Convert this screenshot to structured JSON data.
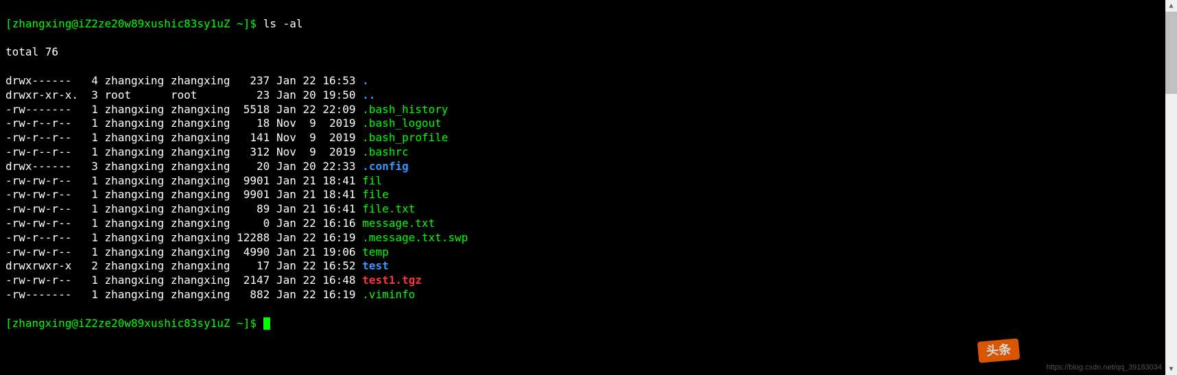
{
  "prompt": "[zhangxing@iZ2ze20w89xushic83sy1uZ ~]$ ",
  "command": "ls -al",
  "total_line": "total 76",
  "rows": [
    {
      "perm": "drwx------ ",
      "links": " 4",
      "owner": "zhangxing",
      "group": "zhangxing",
      "size": "  237",
      "month": "Jan",
      "day": "22",
      "time": "16:53",
      "name": ".",
      "cls": "blue"
    },
    {
      "perm": "drwxr-xr-x.",
      "links": " 3",
      "owner": "root     ",
      "group": "root     ",
      "size": "   23",
      "month": "Jan",
      "day": "20",
      "time": "19:50",
      "name": "..",
      "cls": "blue"
    },
    {
      "perm": "-rw------- ",
      "links": " 1",
      "owner": "zhangxing",
      "group": "zhangxing",
      "size": " 5518",
      "month": "Jan",
      "day": "22",
      "time": "22:09",
      "name": ".bash_history",
      "cls": "green"
    },
    {
      "perm": "-rw-r--r-- ",
      "links": " 1",
      "owner": "zhangxing",
      "group": "zhangxing",
      "size": "   18",
      "month": "Nov",
      "day": " 9",
      "time": " 2019",
      "name": ".bash_logout",
      "cls": "green"
    },
    {
      "perm": "-rw-r--r-- ",
      "links": " 1",
      "owner": "zhangxing",
      "group": "zhangxing",
      "size": "  141",
      "month": "Nov",
      "day": " 9",
      "time": " 2019",
      "name": ".bash_profile",
      "cls": "green"
    },
    {
      "perm": "-rw-r--r-- ",
      "links": " 1",
      "owner": "zhangxing",
      "group": "zhangxing",
      "size": "  312",
      "month": "Nov",
      "day": " 9",
      "time": " 2019",
      "name": ".bashrc",
      "cls": "green"
    },
    {
      "perm": "drwx------ ",
      "links": " 3",
      "owner": "zhangxing",
      "group": "zhangxing",
      "size": "   20",
      "month": "Jan",
      "day": "20",
      "time": "22:33",
      "name": ".config",
      "cls": "blue"
    },
    {
      "perm": "-rw-rw-r-- ",
      "links": " 1",
      "owner": "zhangxing",
      "group": "zhangxing",
      "size": " 9901",
      "month": "Jan",
      "day": "21",
      "time": "18:41",
      "name": "fil",
      "cls": "green"
    },
    {
      "perm": "-rw-rw-r-- ",
      "links": " 1",
      "owner": "zhangxing",
      "group": "zhangxing",
      "size": " 9901",
      "month": "Jan",
      "day": "21",
      "time": "18:41",
      "name": "file",
      "cls": "green"
    },
    {
      "perm": "-rw-rw-r-- ",
      "links": " 1",
      "owner": "zhangxing",
      "group": "zhangxing",
      "size": "   89",
      "month": "Jan",
      "day": "21",
      "time": "16:41",
      "name": "file.txt",
      "cls": "green"
    },
    {
      "perm": "-rw-rw-r-- ",
      "links": " 1",
      "owner": "zhangxing",
      "group": "zhangxing",
      "size": "    0",
      "month": "Jan",
      "day": "22",
      "time": "16:16",
      "name": "message.txt",
      "cls": "green"
    },
    {
      "perm": "-rw-r--r-- ",
      "links": " 1",
      "owner": "zhangxing",
      "group": "zhangxing",
      "size": "12288",
      "month": "Jan",
      "day": "22",
      "time": "16:19",
      "name": ".message.txt.swp",
      "cls": "green"
    },
    {
      "perm": "-rw-rw-r-- ",
      "links": " 1",
      "owner": "zhangxing",
      "group": "zhangxing",
      "size": " 4990",
      "month": "Jan",
      "day": "21",
      "time": "19:06",
      "name": "temp",
      "cls": "green"
    },
    {
      "perm": "drwxrwxr-x ",
      "links": " 2",
      "owner": "zhangxing",
      "group": "zhangxing",
      "size": "   17",
      "month": "Jan",
      "day": "22",
      "time": "16:52",
      "name": "test",
      "cls": "blue"
    },
    {
      "perm": "-rw-rw-r-- ",
      "links": " 1",
      "owner": "zhangxing",
      "group": "zhangxing",
      "size": " 2147",
      "month": "Jan",
      "day": "22",
      "time": "16:48",
      "name": "test1.tgz",
      "cls": "red"
    },
    {
      "perm": "-rw------- ",
      "links": " 1",
      "owner": "zhangxing",
      "group": "zhangxing",
      "size": "  882",
      "month": "Jan",
      "day": "22",
      "time": "16:19",
      "name": ".viminfo",
      "cls": "green"
    }
  ],
  "badge_text": "头条",
  "watermark_text": "https://blog.csdn.net/qq_39183034"
}
